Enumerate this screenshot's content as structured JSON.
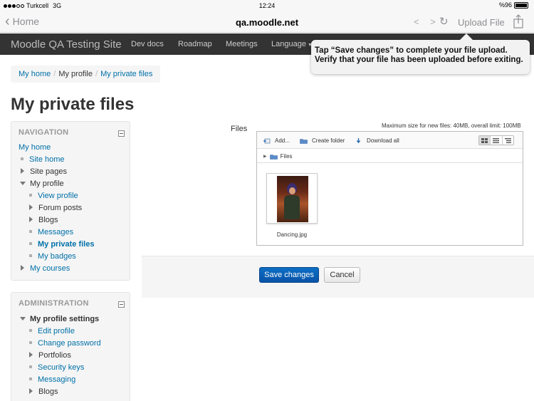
{
  "status_bar": {
    "carrier": "Turkcell",
    "network": "3G",
    "time": "12:24",
    "battery": "%96"
  },
  "browser": {
    "back_label": "Home",
    "url": "qa.moodle.net",
    "nav_arrows": "< >",
    "reload_icon": "reload-icon",
    "upload_label": "Upload File",
    "share_icon": "share-icon"
  },
  "moodle_nav": {
    "brand": "Moodle QA Testing Site",
    "items": [
      "Dev docs",
      "Roadmap",
      "Meetings",
      "Language"
    ]
  },
  "tooltip": {
    "line1": "Tap “Save changes” to complete your file upload.",
    "line2": "Verify that your file has been uploaded before exiting."
  },
  "breadcrumb": [
    "My home",
    "My profile",
    "My private files"
  ],
  "page_title": "My private files",
  "navigation": {
    "heading": "NAVIGATION",
    "items": [
      {
        "label": "My home"
      },
      {
        "label": "Site home"
      },
      {
        "label": "Site pages"
      },
      {
        "label": "My profile"
      },
      {
        "label": "View profile"
      },
      {
        "label": "Forum posts"
      },
      {
        "label": "Blogs"
      },
      {
        "label": "Messages"
      },
      {
        "label": "My private files"
      },
      {
        "label": "My badges"
      },
      {
        "label": "My courses"
      }
    ]
  },
  "administration": {
    "heading": "ADMINISTRATION",
    "items": [
      {
        "label": "My profile settings"
      },
      {
        "label": "Edit profile"
      },
      {
        "label": "Change password"
      },
      {
        "label": "Portfolios"
      },
      {
        "label": "Security keys"
      },
      {
        "label": "Messaging"
      },
      {
        "label": "Blogs"
      }
    ]
  },
  "files": {
    "label": "Files",
    "max_size": "Maximum size for new files: 40MB, overall limit: 100MB",
    "toolbar": {
      "add": "Add...",
      "create_folder": "Create folder",
      "download_all": "Download all"
    },
    "path": "Files",
    "file_name": "Dancing.jpg"
  },
  "buttons": {
    "save": "Save changes",
    "cancel": "Cancel"
  },
  "colors": {
    "link": "#0070a8",
    "nav_bg": "#333333",
    "primary_button": "#0a62b8"
  }
}
